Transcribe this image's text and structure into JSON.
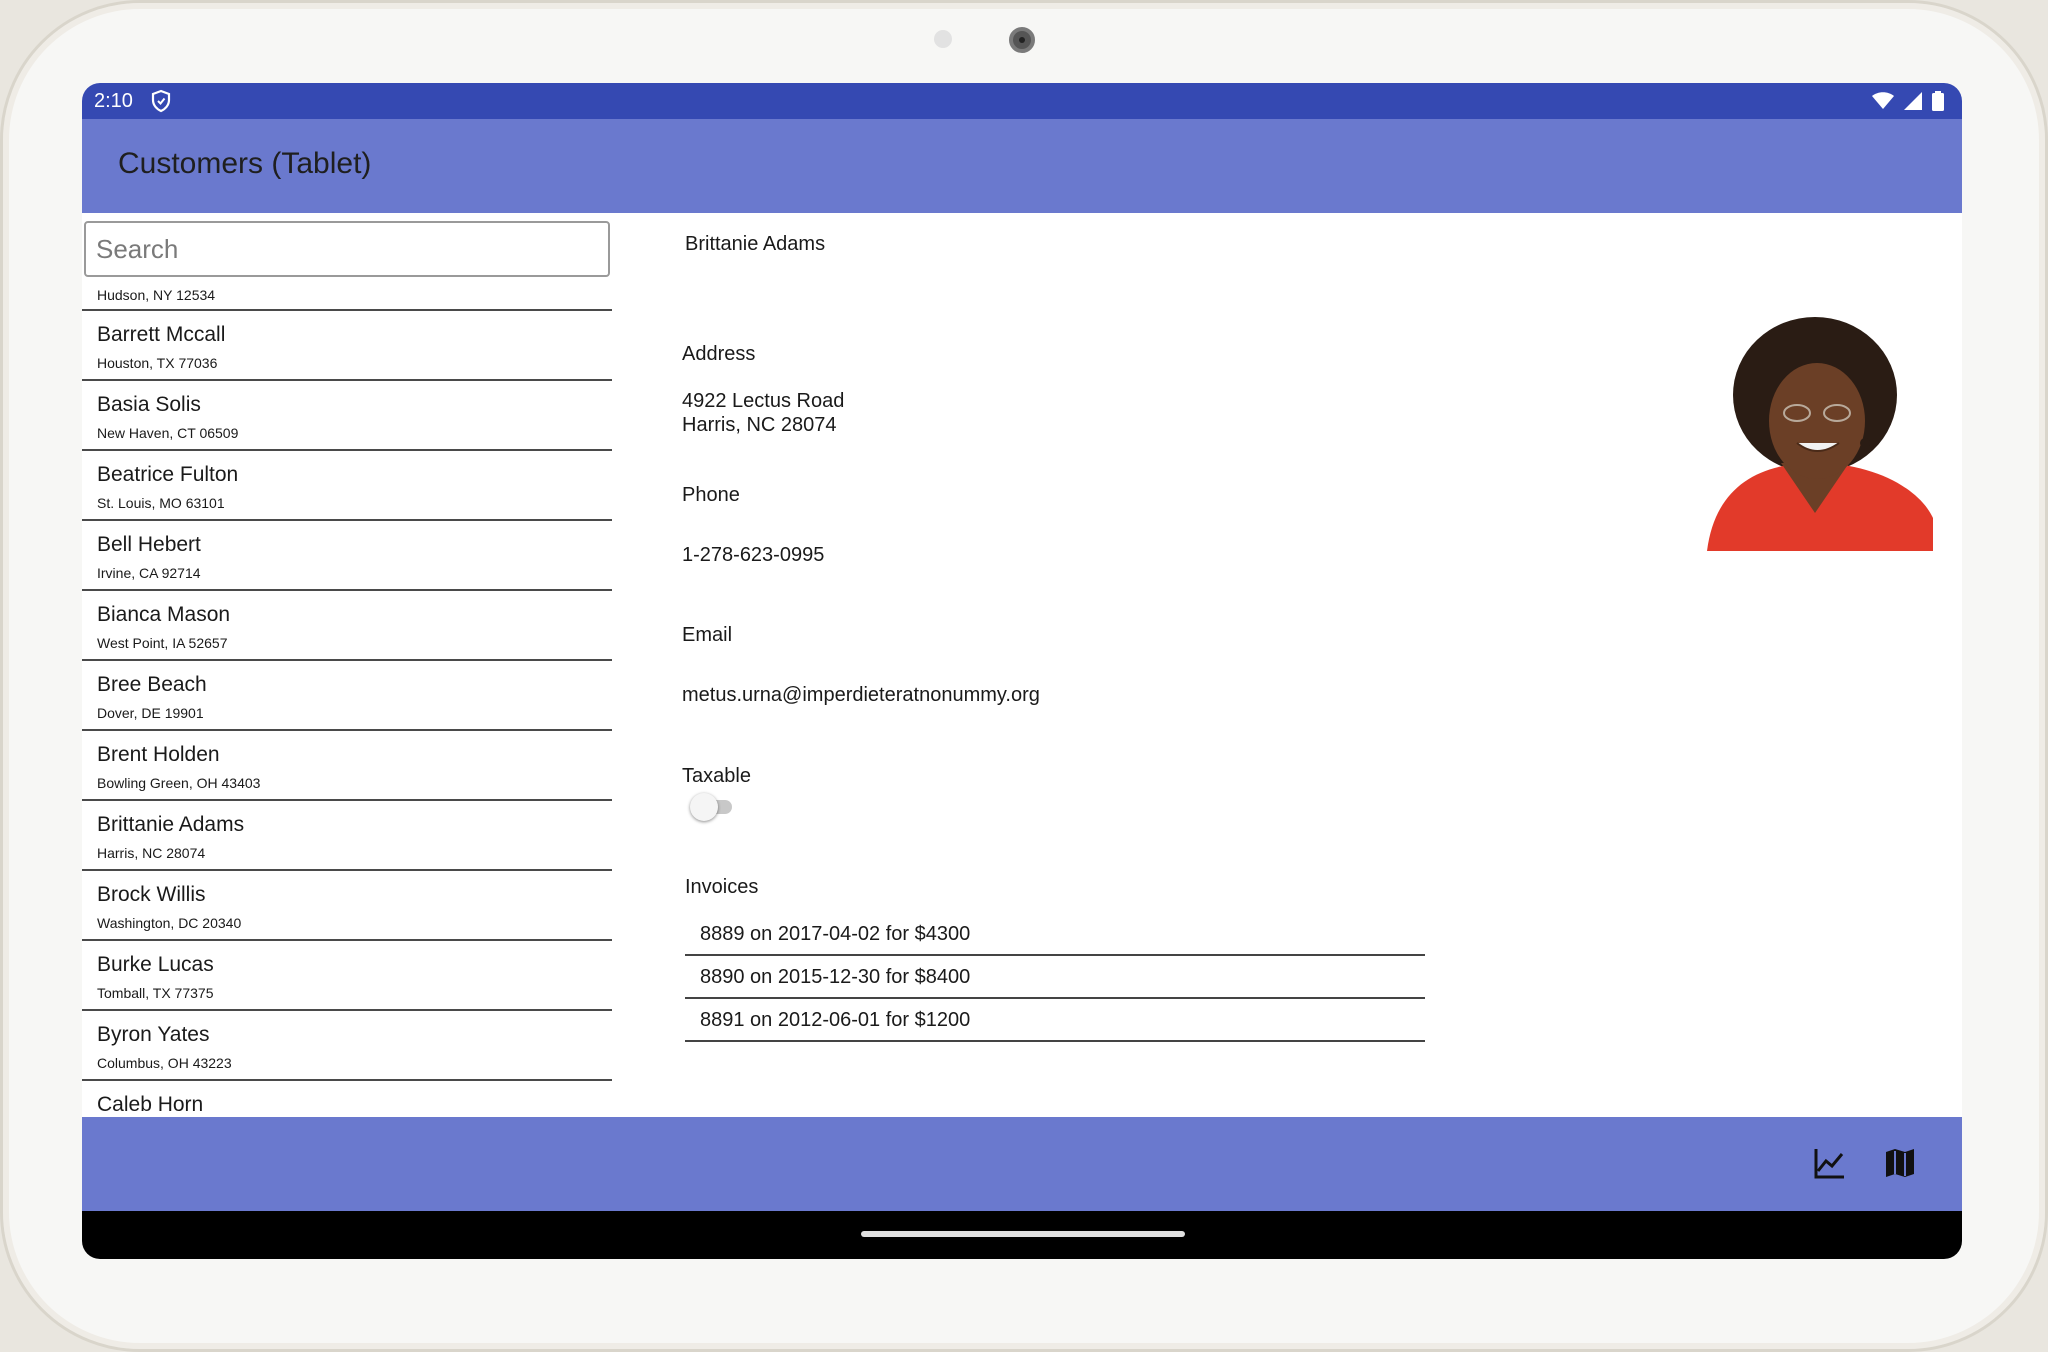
{
  "status_bar": {
    "time": "2:10"
  },
  "app_bar": {
    "title": "Customers (Tablet)"
  },
  "search": {
    "placeholder": "Search"
  },
  "customers": [
    {
      "name": "",
      "address": "Hudson, NY 12534"
    },
    {
      "name": "Barrett Mccall",
      "address": "Houston, TX 77036"
    },
    {
      "name": "Basia Solis",
      "address": "New Haven, CT 06509"
    },
    {
      "name": "Beatrice Fulton",
      "address": "St. Louis, MO 63101"
    },
    {
      "name": "Bell Hebert",
      "address": "Irvine, CA 92714"
    },
    {
      "name": "Bianca Mason",
      "address": "West Point, IA 52657"
    },
    {
      "name": "Bree Beach",
      "address": "Dover, DE 19901"
    },
    {
      "name": "Brent Holden",
      "address": "Bowling Green, OH 43403"
    },
    {
      "name": "Brittanie Adams",
      "address": "Harris, NC 28074"
    },
    {
      "name": "Brock Willis",
      "address": "Washington, DC 20340"
    },
    {
      "name": "Burke Lucas",
      "address": "Tomball, TX 77375"
    },
    {
      "name": "Byron Yates",
      "address": "Columbus, OH 43223"
    },
    {
      "name": "Caleb Horn",
      "address": ""
    }
  ],
  "detail": {
    "name": "Brittanie Adams",
    "address_label": "Address",
    "address_line1": "4922 Lectus Road",
    "address_line2": "Harris, NC 28074",
    "phone_label": "Phone",
    "phone": "1-278-623-0995",
    "email_label": "Email",
    "email": "metus.urna@imperdieteratnonummy.org",
    "taxable_label": "Taxable",
    "taxable": false,
    "invoices_label": "Invoices",
    "invoices": [
      "8889 on 2017-04-02 for $4300",
      "8890 on 2015-12-30 for $8400",
      "8891 on 2012-06-01 for $1200"
    ]
  },
  "bottom_bar": {
    "icons": [
      "chart-icon",
      "map-icon"
    ]
  },
  "colors": {
    "status_bar": "#3549b2",
    "app_bar": "#6a79ce",
    "nav_bar": "#000000"
  }
}
